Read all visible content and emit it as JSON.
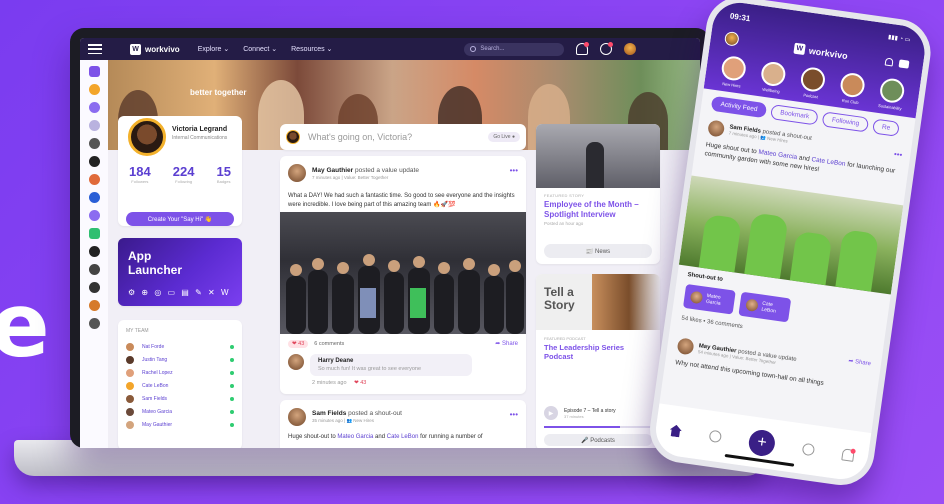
{
  "hero": {
    "big_letter": "e"
  },
  "desktop": {
    "brand": "workvivo",
    "nav": [
      "Explore ⌄",
      "Connect ⌄",
      "Resources ⌄"
    ],
    "search_placeholder": "Search...",
    "banner_text": "better together",
    "profile": {
      "name": "Victoria Legrand",
      "role": "Internal Communications",
      "stats": [
        {
          "value": "184",
          "label": "Followers"
        },
        {
          "value": "224",
          "label": "Following"
        },
        {
          "value": "15",
          "label": "Badges"
        }
      ],
      "create_button": "Create Your \"Say Hi\" 👋"
    },
    "launcher": {
      "title": "App Launcher",
      "icons": "⚙ ⊕ ◎ ▭ ▤ ✎ ✕ W"
    },
    "team": {
      "title": "MY TEAM",
      "members": [
        "Nat Forde",
        "Justin Tang",
        "Rachel Lopez",
        "Cate LeBon",
        "Sam Fields",
        "Mateo Garcia",
        "May Gauthier"
      ]
    },
    "composer": {
      "placeholder": "What's going on, Victoria?",
      "go_live": "Go Live ●"
    },
    "post1": {
      "author": "May Gauthier",
      "action": " posted a value update",
      "meta": "7 minutes ago | Value: Better Together",
      "body": "What a DAY! We had such a fantastic time. So good to see everyone and the insights were incredible. I love being part of this amazing team 🔥🚀💯",
      "likes": "❤ 43",
      "comments": "6 comments",
      "share": "➦ Share",
      "comment_name": "Harry Deane",
      "comment_text": "So much fun! It was great to see everyone",
      "comment_time": "2 minutes ago",
      "comment_likes": "❤ 43"
    },
    "post2": {
      "author": "Sam Fields",
      "action": " posted a shout-out",
      "meta": "35 minutes ago | 👥 New Hires",
      "body_prefix": "Huge shout-out to ",
      "link1": "Mateo Garcia",
      "and": " and ",
      "link2": "Cate LeBon",
      "body_suffix": " for running a number of"
    },
    "spotlight": {
      "label": "FEATURED STORY",
      "title": "Employee of the Month – Spotlight Interview",
      "meta": "Posted an hour ago",
      "news_button": "📰 News"
    },
    "podcast": {
      "image_text": "Tell a Story",
      "label": "FEATURED PODCAST",
      "title": "The Leadership Series Podcast",
      "episode": "Episode 7 – Tell a story",
      "duration": "37 minutes",
      "progress": 0.7,
      "button": "🎤 Podcasts"
    }
  },
  "phone": {
    "time": "09:31",
    "status": "▮▮▮ ◔ ▭",
    "brand": "workvivo",
    "stories": [
      "New Hires",
      "Wellbeing",
      "Podcast",
      "Run Club",
      "Sustainability"
    ],
    "tabs": [
      "Activity Feed",
      "Bookmark",
      "Following",
      "Re"
    ],
    "post": {
      "author": "Sam Fields",
      "action": " posted a shout-out",
      "meta": "7 minutes ago | 👥 New Hires",
      "body_prefix": "Huge shout out to ",
      "link1": "Mateo Garcia",
      "and": " and ",
      "link2": "Cate LeBon",
      "body_suffix": " for launching our community garden with some new hires!"
    },
    "shout_label": "Shout-out to",
    "chips": [
      "Mateo Garcia",
      "Cate LeBon"
    ],
    "likes": "54 likes • 36 comments",
    "share": "➦ Share",
    "post2": {
      "author": "May Gauthier",
      "action": " posted a value update",
      "meta": "54 minutes ago | Value: Better Together",
      "body": "Why not attend this upcoming town-hall on all things"
    }
  }
}
